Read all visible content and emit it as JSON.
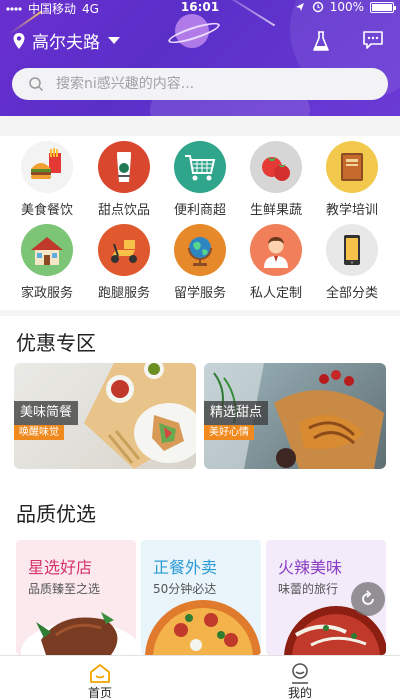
{
  "status_bar": {
    "carrier": "中国移动",
    "network": "4G",
    "time": "16:01",
    "battery": "100%",
    "battery_level": 1.0
  },
  "header": {
    "location": "高尔夫路",
    "search_placeholder": "搜索ni感兴趣的内容..."
  },
  "categories": [
    {
      "label": "美食餐饮",
      "icon": "burger-fries-icon"
    },
    {
      "label": "甜点饮品",
      "icon": "coffee-cup-icon"
    },
    {
      "label": "便利商超",
      "icon": "shopping-cart-icon"
    },
    {
      "label": "生鲜果蔬",
      "icon": "tomato-icon"
    },
    {
      "label": "教学培训",
      "icon": "book-icon"
    },
    {
      "label": "家政服务",
      "icon": "house-icon"
    },
    {
      "label": "跑腿服务",
      "icon": "scooter-icon"
    },
    {
      "label": "留学服务",
      "icon": "globe-icon"
    },
    {
      "label": "私人定制",
      "icon": "person-icon"
    },
    {
      "label": "全部分类",
      "icon": "phone-icon"
    }
  ],
  "promo_section": {
    "title": "优惠专区",
    "cards": [
      {
        "title": "美味简餐",
        "subtitle": "唤醒味觉"
      },
      {
        "title": "精选甜点",
        "subtitle": "美好心情"
      }
    ]
  },
  "quality_section": {
    "title": "品质优选",
    "cards": [
      {
        "title": "星选好店",
        "subtitle": "品质臻至之选",
        "color": "#d6336c"
      },
      {
        "title": "正餐外卖",
        "subtitle": "50分钟必达",
        "color": "#2b9bd6"
      },
      {
        "title": "火辣美味",
        "subtitle": "味蕾的旅行",
        "color": "#8a3fc4"
      }
    ]
  },
  "tab_bar": {
    "tabs": [
      {
        "label": "首页",
        "icon": "home-icon",
        "active": true
      },
      {
        "label": "我的",
        "icon": "profile-icon",
        "active": false
      }
    ]
  },
  "colors": {
    "header": "#5f2fcb",
    "accent": "#f0a500",
    "tag_orange": "#f08a1e"
  }
}
